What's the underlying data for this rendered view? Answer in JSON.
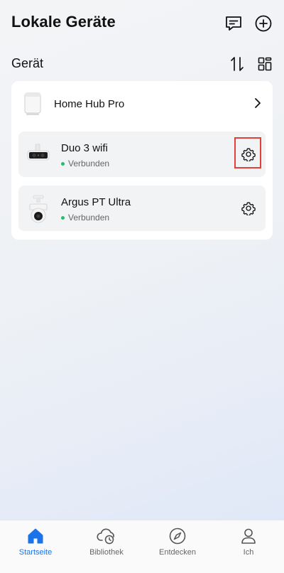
{
  "header": {
    "title": "Lokale Geräte",
    "icons": [
      "message-icon",
      "add-circle-icon"
    ]
  },
  "section": {
    "title": "Gerät",
    "icons": [
      "sort-icon",
      "grid-view-icon"
    ]
  },
  "hub": {
    "name": "Home Hub Pro"
  },
  "devices": [
    {
      "name": "Duo 3 wifi",
      "status": "Verbunden",
      "highlighted": true
    },
    {
      "name": "Argus PT Ultra",
      "status": "Verbunden",
      "highlighted": false
    }
  ],
  "tabs": [
    {
      "label": "Startseite",
      "icon": "home-icon",
      "active": true
    },
    {
      "label": "Bibliothek",
      "icon": "cloud-clock-icon",
      "active": false
    },
    {
      "label": "Entdecken",
      "icon": "compass-icon",
      "active": false
    },
    {
      "label": "Ich",
      "icon": "person-icon",
      "active": false
    }
  ],
  "colors": {
    "accent": "#1a73e8",
    "status_online": "#2fb86f",
    "highlight": "#e0423a"
  }
}
